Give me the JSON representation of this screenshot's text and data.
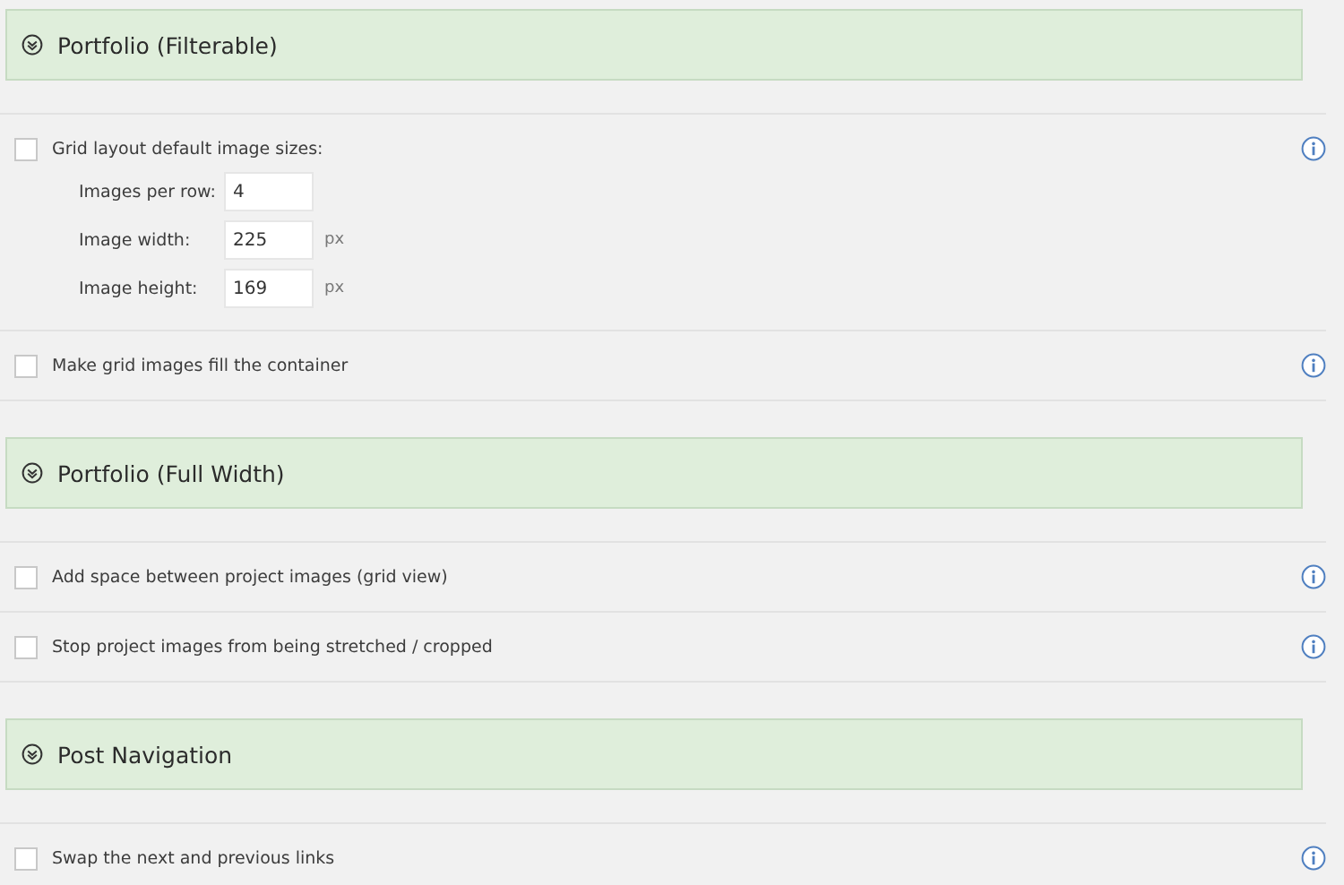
{
  "sections": [
    {
      "title": "Portfolio (Filterable)",
      "options": [
        {
          "kind": "fields",
          "label": "Grid layout default image sizes:",
          "checked": false,
          "fields": [
            {
              "label": "Images per row:",
              "value": "4"
            },
            {
              "label": "Image width:",
              "value": "225",
              "unit": "px"
            },
            {
              "label": "Image height:",
              "value": "169",
              "unit": "px"
            }
          ]
        },
        {
          "kind": "plain",
          "label": "Make grid images fill the container",
          "checked": false
        }
      ]
    },
    {
      "title": "Portfolio (Full Width)",
      "options": [
        {
          "kind": "plain",
          "label": "Add space between project images (grid view)",
          "checked": false
        },
        {
          "kind": "plain",
          "label": "Stop project images from being stretched / cropped",
          "checked": false
        }
      ]
    },
    {
      "title": "Post Navigation",
      "options": [
        {
          "kind": "plain",
          "label": "Swap the next and previous links",
          "checked": false
        }
      ]
    }
  ]
}
